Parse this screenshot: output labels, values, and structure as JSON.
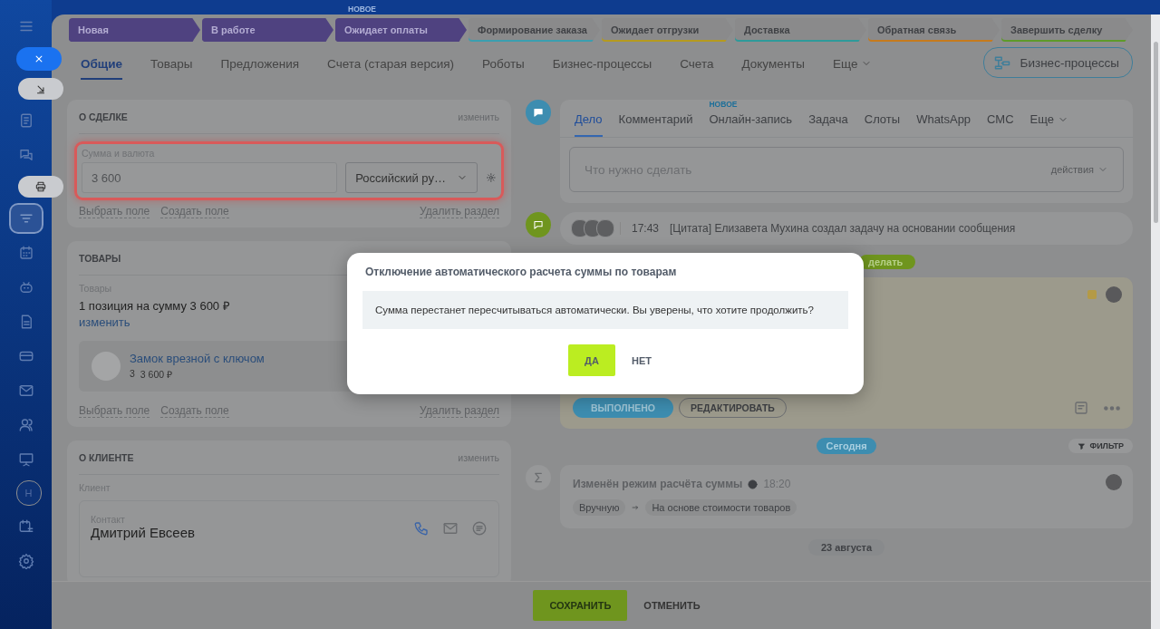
{
  "sidebar": {
    "items": [
      {
        "kind": "menu",
        "selected": false
      },
      {
        "kind": "close",
        "selected": false
      },
      {
        "kind": "collapse",
        "selected": false
      },
      {
        "kind": "document",
        "selected": false
      },
      {
        "kind": "chat",
        "selected": false
      },
      {
        "kind": "printer",
        "selected": false
      },
      {
        "kind": "filter",
        "selected": true
      },
      {
        "kind": "calendar",
        "selected": false
      },
      {
        "kind": "robot",
        "selected": false
      },
      {
        "kind": "file",
        "selected": false
      },
      {
        "kind": "card",
        "selected": false
      },
      {
        "kind": "mail",
        "selected": false
      },
      {
        "kind": "users",
        "selected": false
      },
      {
        "kind": "board",
        "selected": false
      },
      {
        "kind": "avatar",
        "text": "Н",
        "selected": false
      },
      {
        "kind": "schedule",
        "selected": false
      },
      {
        "kind": "settings",
        "selected": false
      }
    ]
  },
  "new_label": "НОВОЕ",
  "stages": [
    {
      "label": "Новая",
      "passed": true,
      "color": "#4f4280"
    },
    {
      "label": "В работе",
      "passed": true,
      "color": "#4f4280"
    },
    {
      "label": "Ожидает оплаты",
      "passed": true,
      "color": "#4f4280"
    },
    {
      "label": "Формирование заказа",
      "passed": false,
      "color": "#3a9fb0"
    },
    {
      "label": "Ожидает отгрузки",
      "passed": false,
      "color": "#b59a1e"
    },
    {
      "label": "Доставка",
      "passed": false,
      "color": "#2e9a9a"
    },
    {
      "label": "Обратная связь",
      "passed": false,
      "color": "#c67a1c"
    },
    {
      "label": "Завершить сделку",
      "passed": false,
      "color": "#5e9a2a"
    }
  ],
  "tabs": [
    {
      "label": "Общие",
      "kind": "tab",
      "selected": true
    },
    {
      "label": "Товары",
      "kind": "tab",
      "selected": false
    },
    {
      "label": "Предложения",
      "kind": "tab",
      "selected": false
    },
    {
      "label": "Счета (старая версия)",
      "kind": "tab",
      "selected": false
    },
    {
      "label": "Роботы",
      "kind": "tab",
      "selected": false
    },
    {
      "label": "Бизнес-процессы",
      "kind": "tab",
      "selected": false
    },
    {
      "label": "Счета",
      "kind": "tab",
      "selected": false
    },
    {
      "label": "Документы",
      "kind": "tab",
      "selected": false
    },
    {
      "label": "Еще",
      "kind": "more",
      "selected": false
    }
  ],
  "business_process_button": "Бизнес-процессы",
  "deal_section": {
    "title": "О СДЕЛКЕ",
    "edit_link": "изменить",
    "field": {
      "label": "Сумма и валюта",
      "value": "3 600",
      "disabled": true,
      "currency": "Российский ру…",
      "highlighted": true
    },
    "links": [
      "Выбрать поле",
      "Создать поле"
    ],
    "delete_link": "Удалить раздел"
  },
  "products_section": {
    "title": "ТОВАРЫ",
    "field_label": "Товары",
    "summary": "1 позиция на сумму 3 600 ₽",
    "change_link": "изменить",
    "items": [
      {
        "name": "Замок врезной с ключом",
        "quantity": "3",
        "price": "3 600 ₽"
      }
    ],
    "links": [
      "Выбрать поле",
      "Создать поле"
    ],
    "delete_link": "Удалить раздел"
  },
  "client_section": {
    "title": "О КЛИЕНТЕ",
    "edit_link": "изменить",
    "field_label": "Клиент",
    "contact": {
      "label": "Контакт",
      "name": "Дмитрий Евсеев"
    }
  },
  "composer": {
    "tabs": [
      {
        "label": "Дело",
        "selected": true
      },
      {
        "label": "Комментарий",
        "selected": false
      },
      {
        "label": "Онлайн-запись",
        "badge": "НОВОЕ",
        "selected": false
      },
      {
        "label": "Задача",
        "selected": false
      },
      {
        "label": "Слоты",
        "selected": false
      },
      {
        "label": "WhatsApp",
        "selected": false
      },
      {
        "label": "СМС",
        "selected": false
      },
      {
        "label": "Еще",
        "selected": false
      }
    ],
    "placeholder": "Что нужно сделать",
    "actions": "действия"
  },
  "comment": {
    "time": "17:43",
    "text": "[Цитата] Елизавета Мухина создал задачу на основании сообщения"
  },
  "task": {
    "status_pill": "делать",
    "done_button": "ВЫПОЛНЕНО",
    "edit_button": "РЕДАКТИРОВАТЬ"
  },
  "today": "Сегодня",
  "filter": "ФИЛЬТР",
  "history": {
    "title": "Изменён режим расчёта суммы",
    "time": "18:20",
    "from": "Вручную",
    "to": "На основе стоимости товаров"
  },
  "date": "23 августа",
  "dialog": {
    "title": "Отключение автоматического расчета суммы по товарам",
    "message": "Сумма перестанет пересчитываться автоматически. Вы уверены, что хотите продолжить?",
    "confirm": "ДА",
    "cancel": "НЕТ"
  },
  "footer": {
    "save": "СОХРАНИТЬ",
    "cancel": "ОТМЕНИТЬ"
  }
}
